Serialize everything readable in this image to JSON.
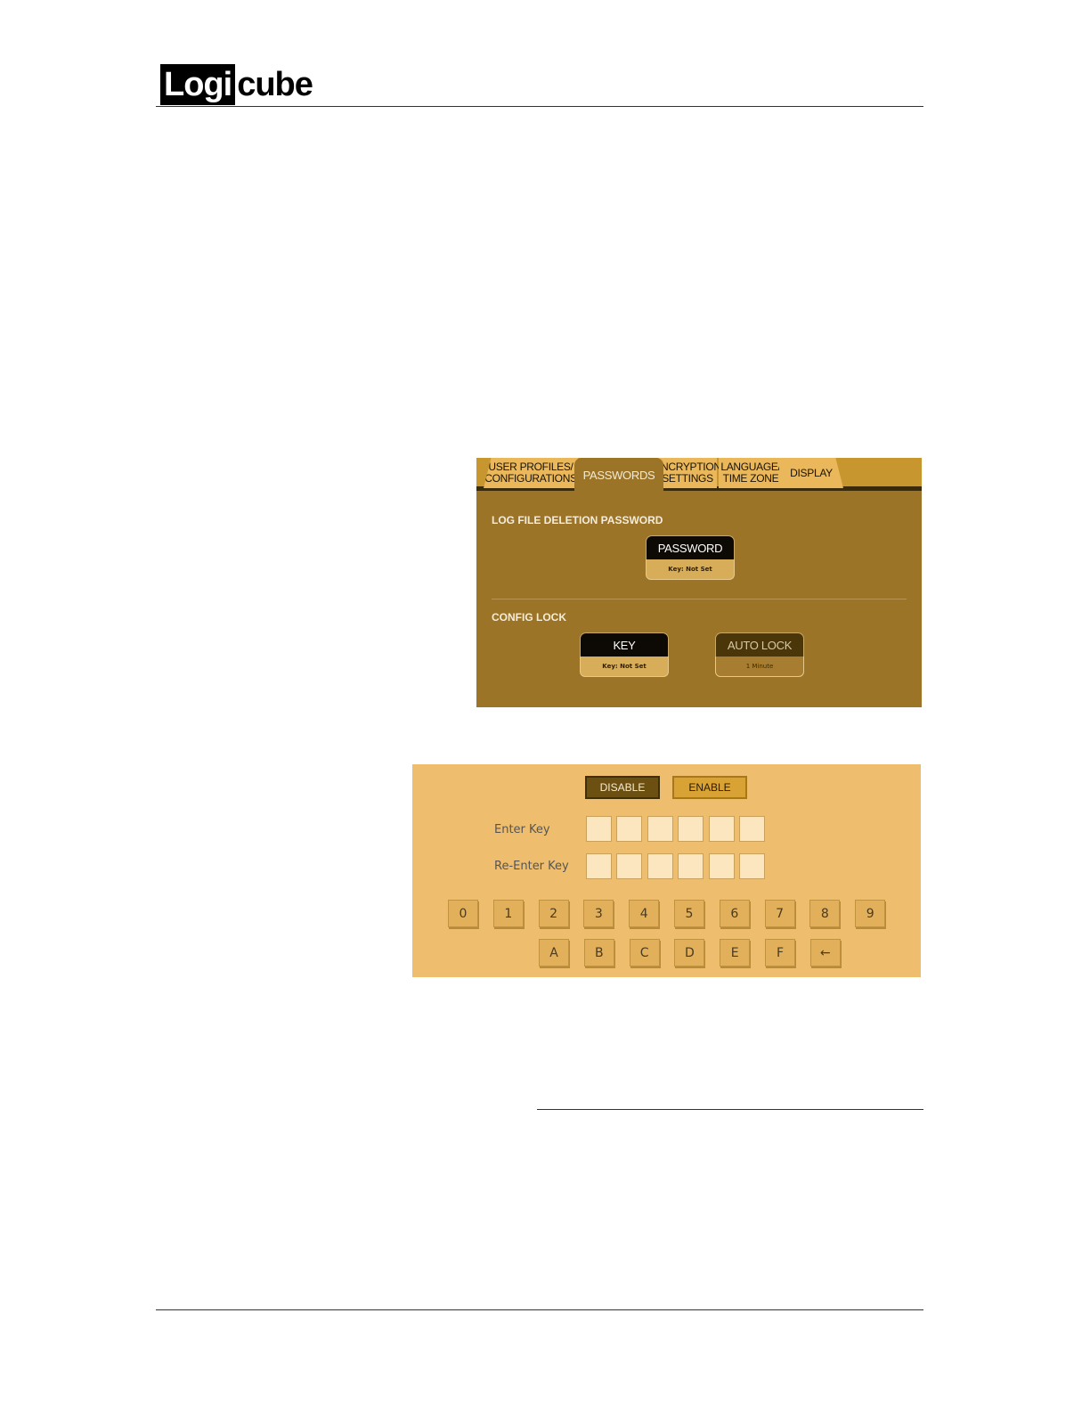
{
  "header": {
    "logo_block": "Logi",
    "logo_rest": "cube"
  },
  "settings_screen": {
    "tabs": [
      {
        "label": "USER PROFILES/\nCONFIGURATIONS",
        "active": false
      },
      {
        "label": "PASSWORDS",
        "active": true
      },
      {
        "label": "ENCRYPTION\nSETTINGS",
        "active": false
      },
      {
        "label": "LANGUAGE/\nTIME ZONE",
        "active": false
      },
      {
        "label": "DISPLAY",
        "active": false
      }
    ],
    "log_section_label": "LOG FILE DELETION PASSWORD",
    "password_button": {
      "label": "PASSWORD",
      "value": "Key: Not Set"
    },
    "config_section_label": "CONFIG LOCK",
    "key_button": {
      "label": "KEY",
      "value": "Key: Not Set"
    },
    "autolock_button": {
      "label": "AUTO LOCK",
      "value": "1 Minute"
    }
  },
  "keypad_screen": {
    "disable_label": "DISABLE",
    "enable_label": "ENABLE",
    "enter_key_label": "Enter Key",
    "reenter_key_label": "Re-Enter Key",
    "digit_keys": [
      "0",
      "1",
      "2",
      "3",
      "4",
      "5",
      "6",
      "7",
      "8",
      "9"
    ],
    "letter_keys": [
      "A",
      "B",
      "C",
      "D",
      "E",
      "F",
      "←"
    ]
  }
}
